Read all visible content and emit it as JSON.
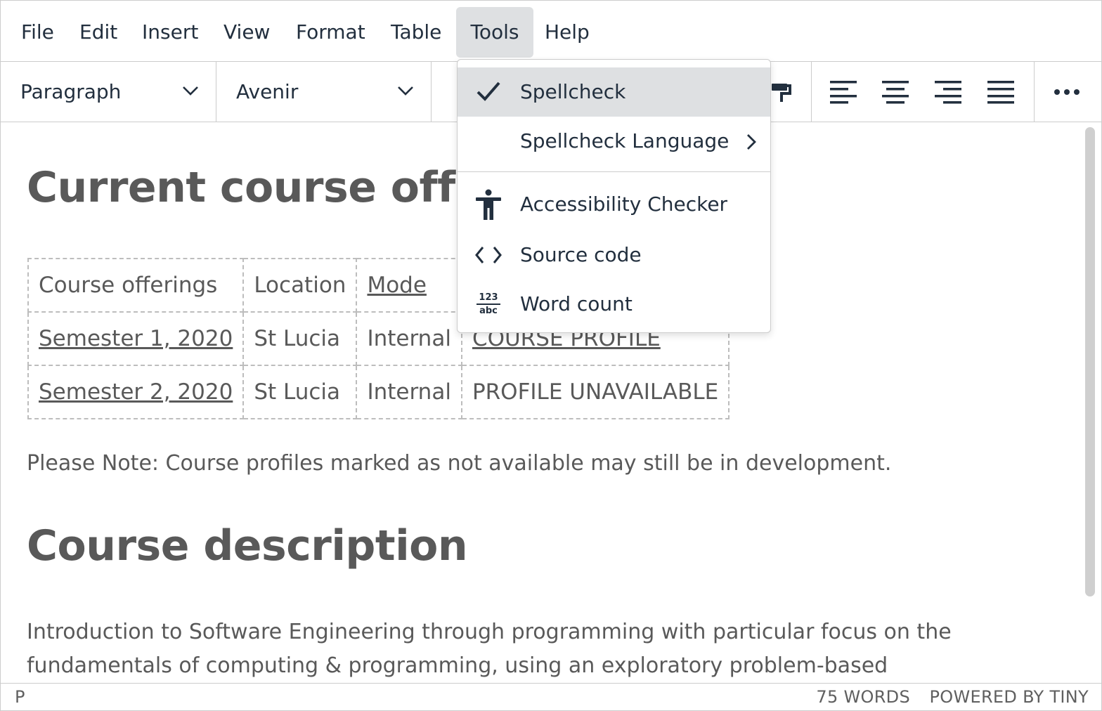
{
  "menubar": {
    "items": [
      "File",
      "Edit",
      "Insert",
      "View",
      "Format",
      "Table",
      "Tools",
      "Help"
    ],
    "active": "Tools"
  },
  "toolbar": {
    "block_format": "Paragraph",
    "font_family": "Avenir"
  },
  "tools_menu": {
    "items": [
      {
        "label": "Spellcheck",
        "icon": "checkmark-icon",
        "checked": true
      },
      {
        "label": "Spellcheck Language",
        "icon": "",
        "submenu": true
      },
      {
        "label": "Accessibility Checker",
        "icon": "accessibility-icon"
      },
      {
        "label": "Source code",
        "icon": "source-code-icon"
      },
      {
        "label": "Word count",
        "icon": "word-count-icon",
        "icon_text_top": "123",
        "icon_text_bottom": "abc"
      }
    ]
  },
  "content": {
    "heading1": "Current course offerings",
    "table": {
      "headers": [
        "Course offerings",
        "Location",
        "Mode",
        ""
      ],
      "rows": [
        [
          "Semester 1, 2020",
          "St Lucia",
          "Internal",
          "COURSE PROFILE"
        ],
        [
          "Semester 2, 2020",
          "St Lucia",
          "Internal",
          "PROFILE UNAVAILABLE"
        ]
      ]
    },
    "note": "Please Note: Course profiles marked as not available may still be in development.",
    "heading2": "Course description",
    "description_line1": "Introduction to Software Engineering through programming with particular focus on the",
    "description_line2": "fundamentals of computing & programming, using an exploratory problem-based"
  },
  "statusbar": {
    "path": "P",
    "word_count": "75 WORDS",
    "branding": "POWERED BY TINY"
  },
  "colors": {
    "text": "#222f3e",
    "content_text": "#595959",
    "active_bg": "#dee0e2",
    "border": "#cccccc"
  }
}
